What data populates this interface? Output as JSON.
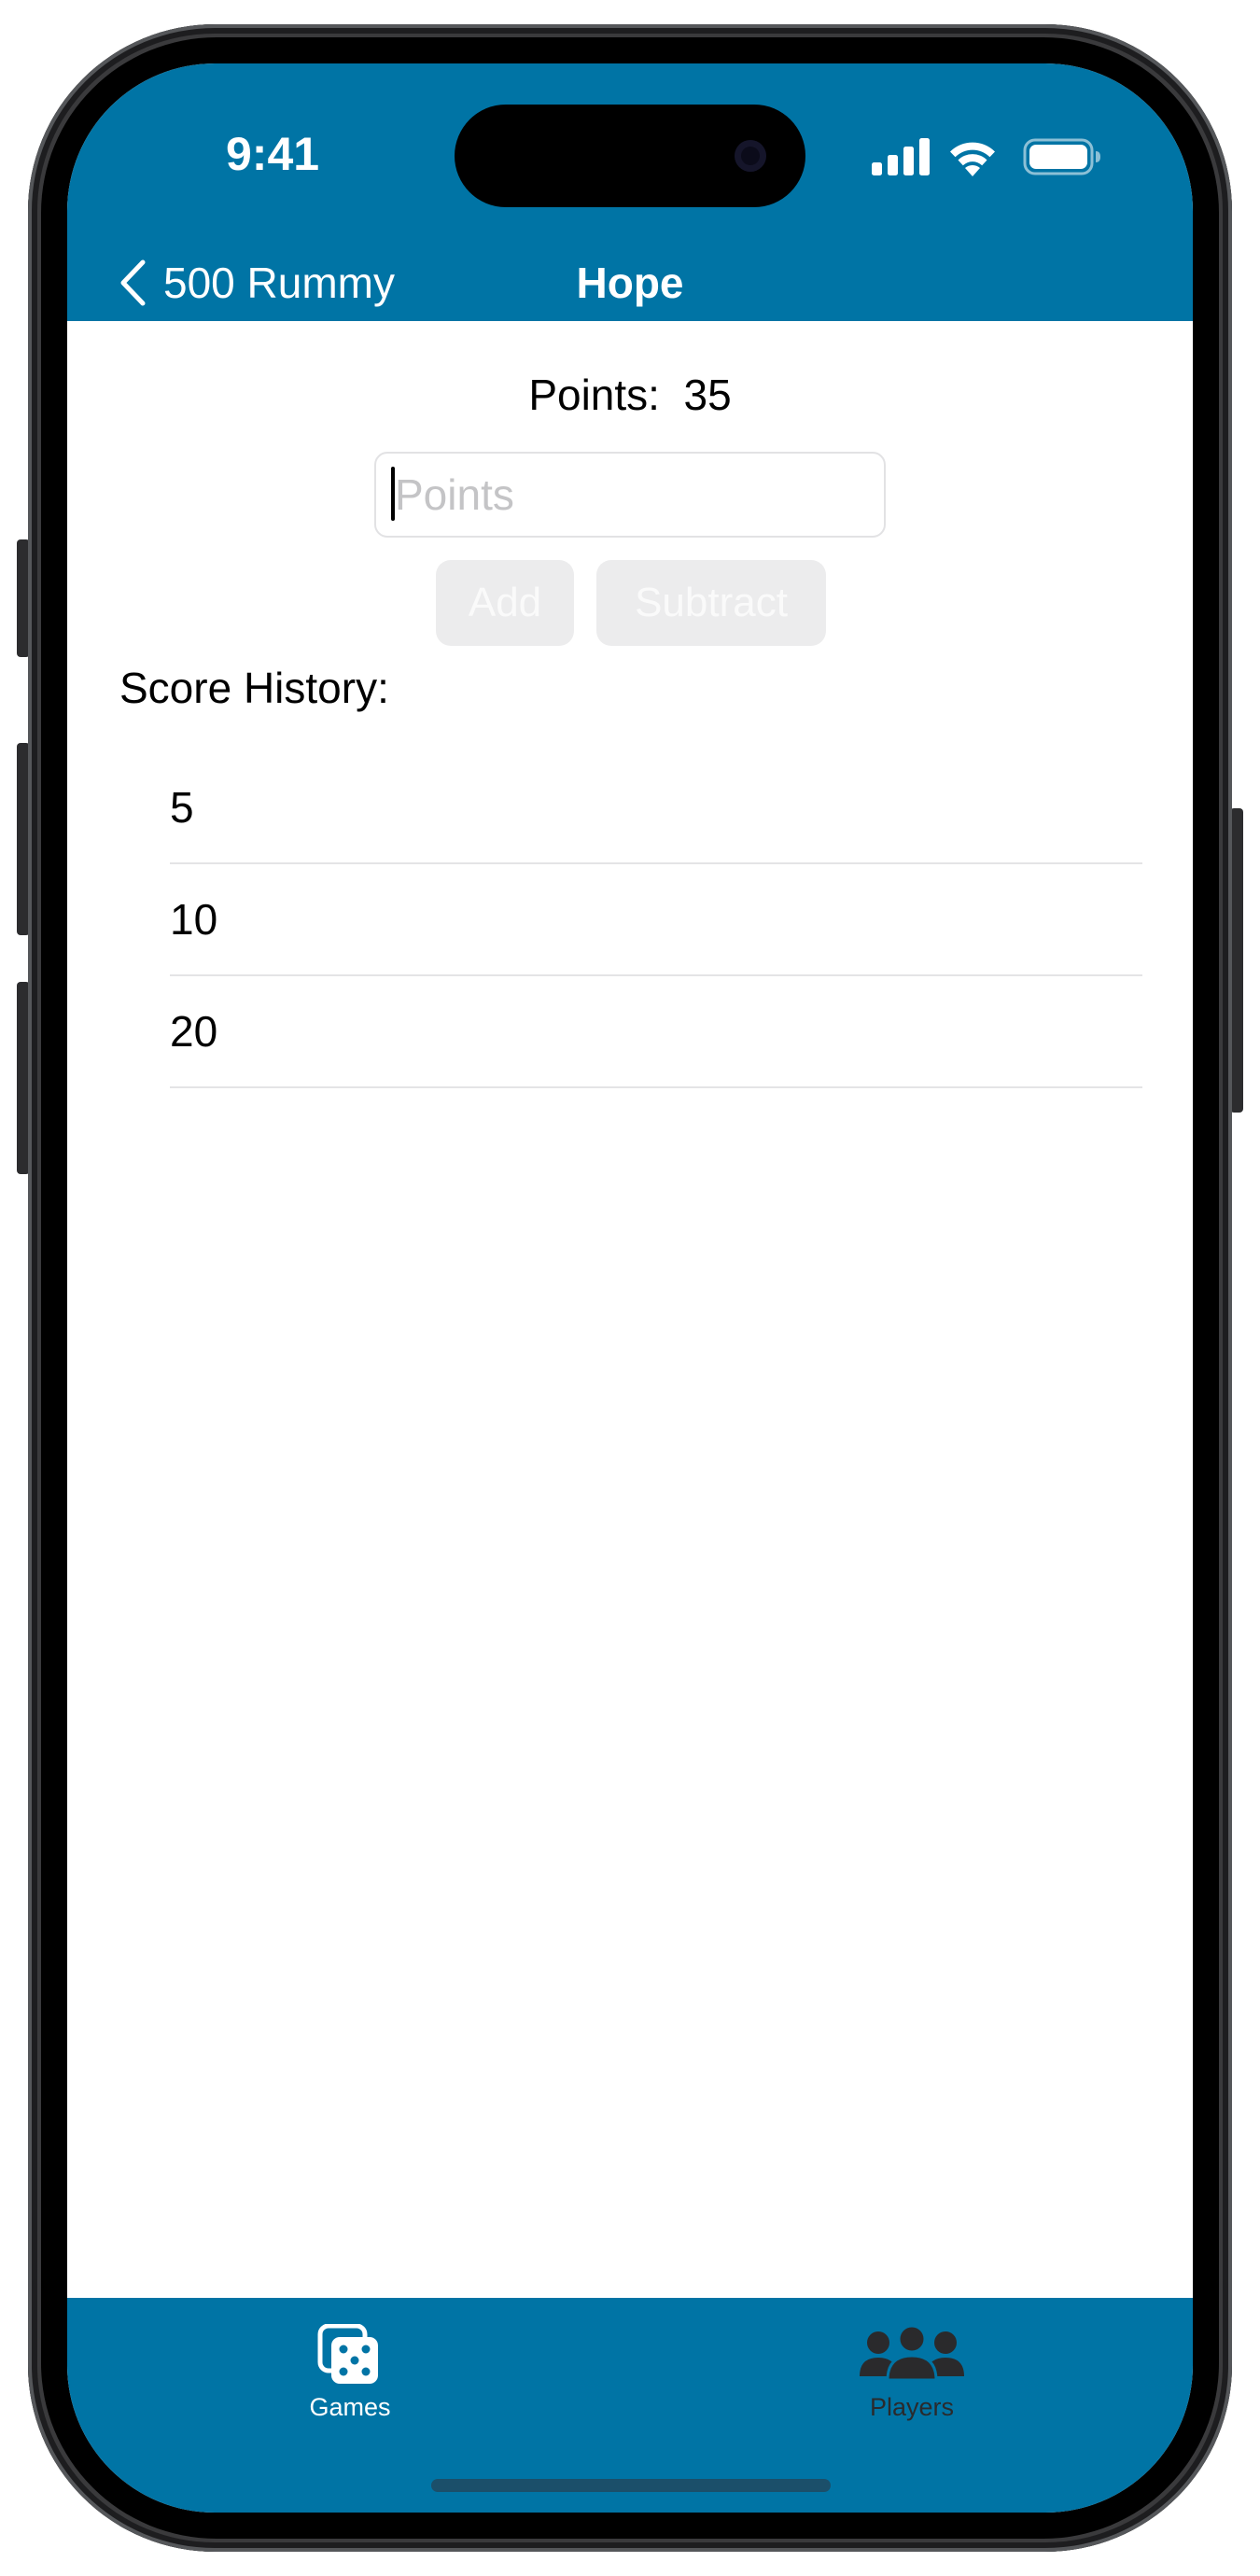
{
  "status_bar": {
    "time": "9:41"
  },
  "nav": {
    "back_label": "500 Rummy",
    "title": "Hope"
  },
  "score": {
    "points_label": "Points:",
    "points_value": "35",
    "input_placeholder": "Points",
    "input_value": "",
    "add_label": "Add",
    "subtract_label": "Subtract"
  },
  "history": {
    "label": "Score History:",
    "items": [
      "5",
      "10",
      "20"
    ]
  },
  "tabs": [
    {
      "label": "Games",
      "icon": "dice-icon",
      "selected": true
    },
    {
      "label": "Players",
      "icon": "people-icon",
      "selected": false
    }
  ],
  "colors": {
    "brand": "#0074a5",
    "tab_selected": "#ffffff",
    "tab_unselected": "#2a2a2c",
    "disabled_button_bg": "#ececed"
  }
}
